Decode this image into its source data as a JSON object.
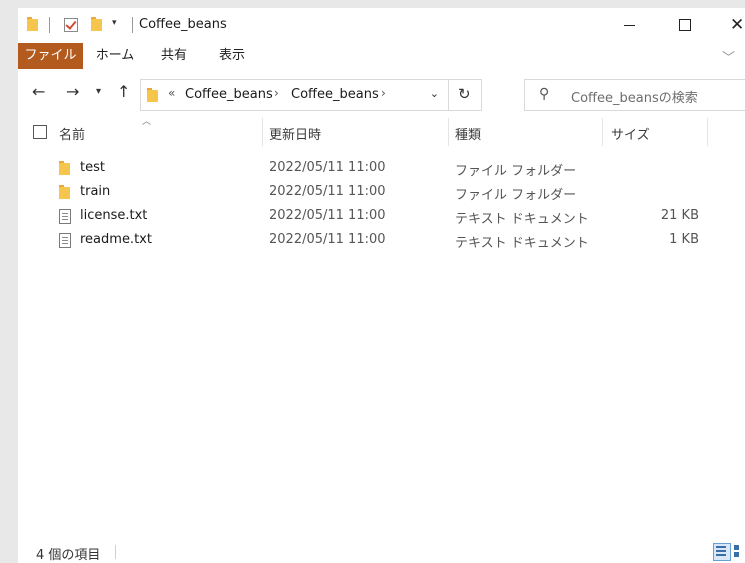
{
  "window": {
    "title": "Coffee_beans"
  },
  "ribbon": {
    "tabs": [
      "ファイル",
      "ホーム",
      "共有",
      "表示"
    ]
  },
  "address": {
    "overflow": "«",
    "crumbs": [
      "Coffee_beans",
      "Coffee_beans"
    ]
  },
  "search": {
    "placeholder": "Coffee_beansの検索"
  },
  "columns": {
    "name": "名前",
    "date": "更新日時",
    "type": "種類",
    "size": "サイズ"
  },
  "files": [
    {
      "name": "test",
      "date": "2022/05/11 11:00",
      "type": "ファイル フォルダー",
      "size": "",
      "icon": "folder-icon"
    },
    {
      "name": "train",
      "date": "2022/05/11 11:00",
      "type": "ファイル フォルダー",
      "size": "",
      "icon": "folder-icon"
    },
    {
      "name": "license.txt",
      "date": "2022/05/11 11:00",
      "type": "テキスト ドキュメント",
      "size": "21 KB",
      "icon": "text-file-icon"
    },
    {
      "name": "readme.txt",
      "date": "2022/05/11 11:00",
      "type": "テキスト ドキュメント",
      "size": "1 KB",
      "icon": "text-file-icon"
    }
  ],
  "status": {
    "count": "4 個の項目"
  },
  "colors": {
    "file_tab": "#b35a1f",
    "folder": "#f5c54c",
    "accent": "#3a6ea8"
  }
}
